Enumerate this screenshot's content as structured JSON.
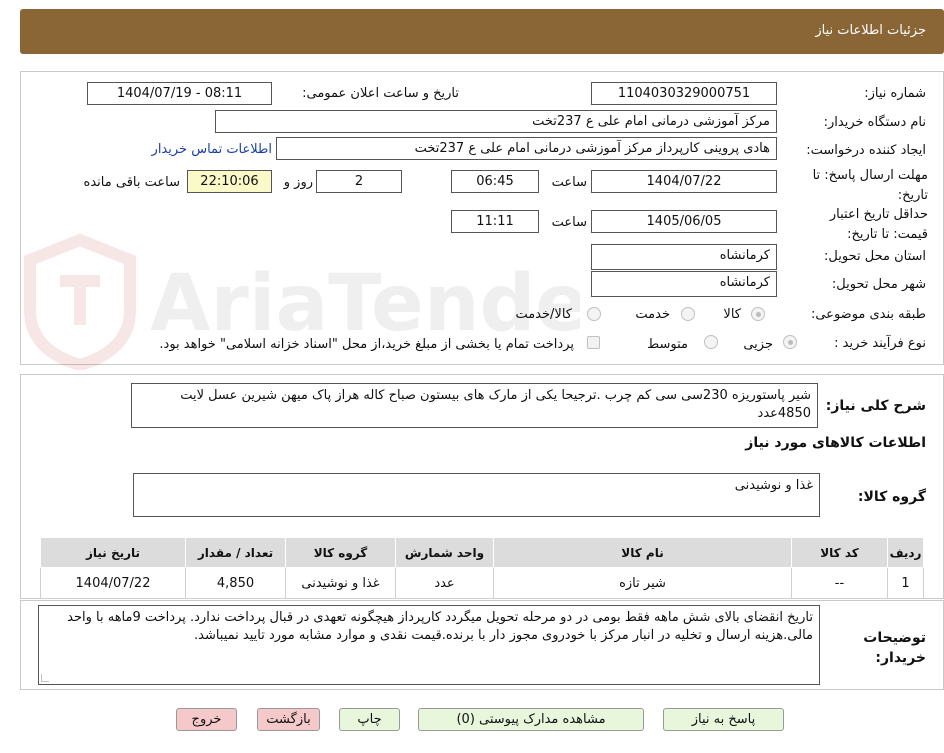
{
  "header": {
    "title": "جزئیات اطلاعات نیاز"
  },
  "form": {
    "need_number_label": "شماره نیاز:",
    "need_number": "1104030329000751",
    "announce_label": "تاریخ و ساعت اعلان عمومی:",
    "announce_value": "1404/07/19 - 08:11",
    "buyer_org_label": "نام دستگاه خریدار:",
    "buyer_org": "مرکز آموزشی درمانی امام علی ع 237تخت",
    "creator_label": "ایجاد کننده درخواست:",
    "creator": "هادی پروینی کارپرداز  مرکز آموزشی درمانی امام علی ع 237تخت",
    "contact_link": "اطلاعات تماس خریدار",
    "deadline_label": "مهلت ارسال پاسخ: تا تاریخ:",
    "deadline_date": "1404/07/22",
    "time_label": "ساعت",
    "deadline_time": "06:45",
    "days_value": "2",
    "days_label": "روز و",
    "remaining_time": "22:10:06",
    "remaining_label": "ساعت باقی مانده",
    "validity_label": "حداقل تاریخ اعتبار قیمت: تا تاریخ:",
    "validity_date": "1405/06/05",
    "validity_time": "11:11",
    "province_label": "استان محل تحویل:",
    "province": "کرمانشاه",
    "city_label": "شهر محل تحویل:",
    "city": "کرمانشاه",
    "category_label": "طبقه بندی موضوعی:",
    "category_options": [
      "کالا",
      "خدمت",
      "کالا/خدمت"
    ],
    "category_selected": "کالا",
    "process_label": "نوع فرآیند خرید :",
    "process_options": [
      "جزیی",
      "متوسط"
    ],
    "process_selected": "جزیی",
    "payment_note": "پرداخت تمام یا بخشی از مبلغ خرید،از محل \"اسناد خزانه اسلامی\" خواهد بود."
  },
  "description": {
    "label": "شرح کلی نیاز:",
    "text": "شیر پاستوریزه 230سی سی کم چرب .ترجیحا یکی از مارک های  بیستون صباح  کاله هراز پاک میهن شیرین عسل لایت    4850عدد"
  },
  "goods_section": {
    "title": "اطلاعات کالاهای مورد نیاز",
    "group_label": "گروه کالا:",
    "group_value": "غذا و نوشیدنی"
  },
  "table": {
    "headers": [
      "ردیف",
      "کد کالا",
      "نام کالا",
      "واحد شمارش",
      "گروه کالا",
      "تعداد / مقدار",
      "تاریخ نیاز"
    ],
    "rows": [
      [
        "1",
        "--",
        "شیر تازه",
        "عدد",
        "غذا و نوشیدنی",
        "4,850",
        "1404/07/22"
      ]
    ]
  },
  "buyer_notes": {
    "label": "توضیحات خریدار:",
    "text": "تاریخ انقضای بالای شش ماهه فقط بومی در دو مرحله تحویل میگردد کارپرداز هیچگونه  تعهدی در قبال پرداخت ندارد. پرداخت 9ماهه با واحد مالی.هزینه ارسال و تخلیه در انبار مرکز با خودروی مجوز دار با برنده.قیمت نقدی و موارد مشابه مورد تایید نمیباشد."
  },
  "buttons": {
    "respond": "پاسخ به نیاز",
    "attachments": "مشاهده مدارک پیوستی (0)",
    "print": "چاپ",
    "back": "بازگشت",
    "exit": "خروج"
  },
  "watermark": {
    "text": "AriaTender.neT"
  }
}
